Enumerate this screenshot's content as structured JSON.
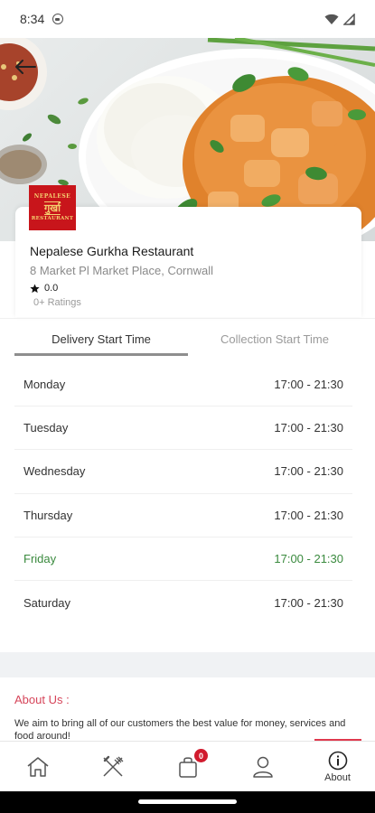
{
  "status_bar": {
    "time": "8:34"
  },
  "restaurant": {
    "logo_lines": [
      "NEPALESE",
      "गुर्खा",
      "RESTAURANT"
    ],
    "name": "Nepalese Gurkha Restaurant",
    "address": "8 Market Pl Market Place, Cornwall",
    "rating": "0.0",
    "ratings_count": "0+ Ratings"
  },
  "tabs": {
    "delivery": "Delivery Start Time",
    "collection": "Collection Start Time",
    "active": "delivery"
  },
  "schedule": [
    {
      "day": "Monday",
      "time": "17:00 - 21:30",
      "today": false
    },
    {
      "day": "Tuesday",
      "time": "17:00 - 21:30",
      "today": false
    },
    {
      "day": "Wednesday",
      "time": "17:00 - 21:30",
      "today": false
    },
    {
      "day": "Thursday",
      "time": "17:00 - 21:30",
      "today": false
    },
    {
      "day": "Friday",
      "time": "17:00 - 21:30",
      "today": true
    },
    {
      "day": "Saturday",
      "time": "17:00 - 21:30",
      "today": false
    }
  ],
  "about": {
    "title": "About Us :",
    "text": "We aim to bring all of our customers the best value for money, services and food around!"
  },
  "nav": {
    "items": [
      {
        "icon": "home-icon",
        "label": ""
      },
      {
        "icon": "fork-knife-icon",
        "label": ""
      },
      {
        "icon": "shopping-bag-icon",
        "label": "",
        "badge": "0"
      },
      {
        "icon": "user-icon",
        "label": ""
      },
      {
        "icon": "info-icon",
        "label": "About"
      }
    ]
  },
  "colors": {
    "accent_red": "#d6455a",
    "today_green": "#3a8a3e",
    "badge_red": "#d11b2e",
    "logo_red": "#c8151b"
  }
}
